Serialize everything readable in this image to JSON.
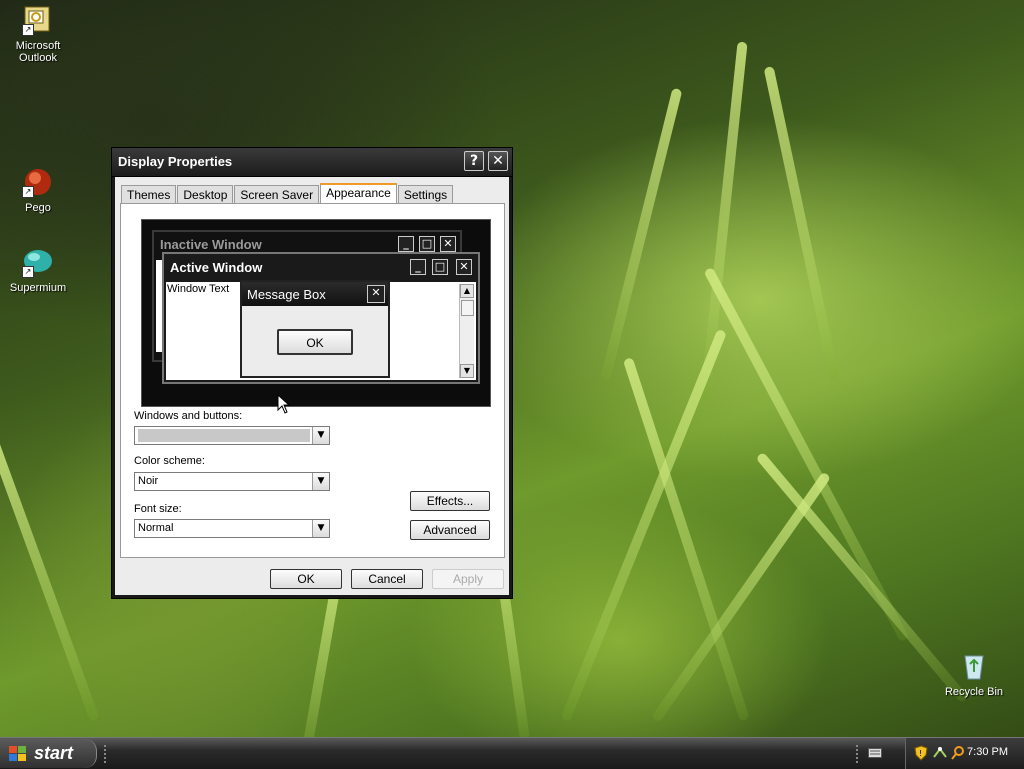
{
  "desktop": {
    "icons": [
      {
        "label": "Microsoft Outlook",
        "icon": "outlook-icon"
      },
      {
        "label": "Pego",
        "icon": "pego-icon"
      },
      {
        "label": "Supermium",
        "icon": "supermium-icon"
      },
      {
        "label": "Recycle Bin",
        "icon": "recycle-bin-icon"
      }
    ]
  },
  "dialog": {
    "title": "Display Properties",
    "help_glyph": "?",
    "close_glyph": "✕",
    "tabs": [
      {
        "label": "Themes",
        "active": false
      },
      {
        "label": "Desktop",
        "active": false
      },
      {
        "label": "Screen Saver",
        "active": false
      },
      {
        "label": "Appearance",
        "active": true
      },
      {
        "label": "Settings",
        "active": false
      }
    ],
    "preview": {
      "inactive_title": "Inactive Window",
      "active_title": "Active Window",
      "window_text": "Window Text",
      "message_box_title": "Message Box",
      "message_box_ok": "OK"
    },
    "fields": {
      "windows_buttons_label": "Windows and buttons:",
      "windows_buttons_value": "",
      "color_scheme_label": "Color scheme:",
      "color_scheme_value": "Noir",
      "font_size_label": "Font size:",
      "font_size_value": "Normal"
    },
    "buttons": {
      "effects": "Effects...",
      "advanced": "Advanced",
      "ok": "OK",
      "cancel": "Cancel",
      "apply": "Apply"
    }
  },
  "taskbar": {
    "start_label": "start",
    "clock": "7:30 PM"
  },
  "colors": {
    "accent_tab": "#f09a2a",
    "title_bar": "#1c1c1c",
    "inactive_title_text": "#9a9a9a",
    "active_title_text": "#ffffff"
  }
}
